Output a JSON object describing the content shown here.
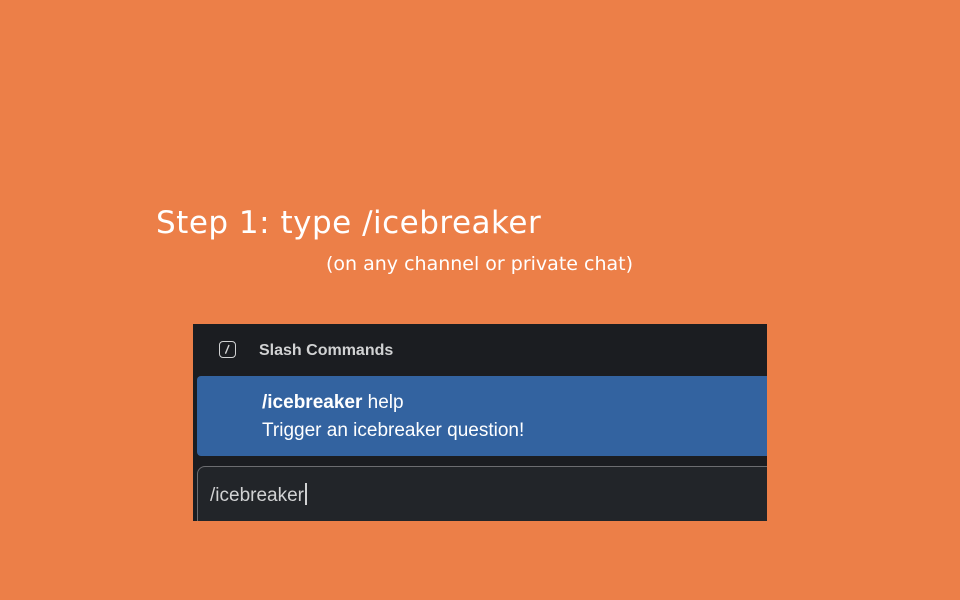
{
  "instructions": {
    "title": "Step 1: type /icebreaker",
    "subtitle": "(on any channel or private chat)"
  },
  "popup": {
    "header_icon": "slash-icon",
    "header_label": "Slash Commands",
    "suggestion": {
      "command": "/icebreaker",
      "argument": " help",
      "description": "Trigger an icebreaker question!"
    }
  },
  "composer": {
    "value": "/icebreaker"
  },
  "colors": {
    "background": "#EC7F48",
    "panel": "#1B1D21",
    "highlight": "#3363A0",
    "text": "#FFFFFF"
  }
}
